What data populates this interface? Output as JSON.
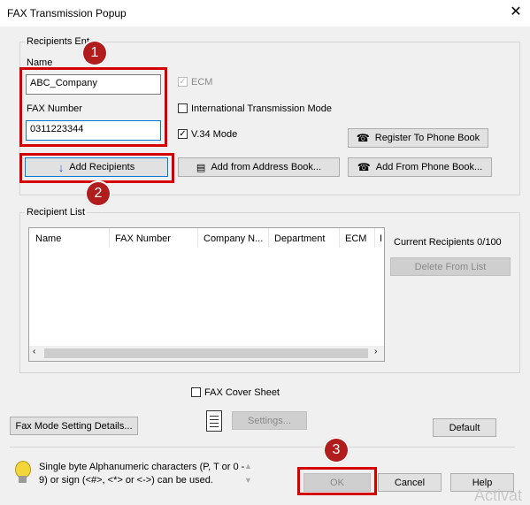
{
  "window": {
    "title": "FAX Transmission Popup",
    "close_glyph": "✕"
  },
  "recipients_entry": {
    "legend": "Recipients Ent",
    "name_label": "Name",
    "name_value": "ABC_Company",
    "fax_label": "FAX Number",
    "fax_value": "0311223344",
    "ecm_label": "ECM",
    "intl_label": "International Transmission Mode",
    "v34_label": "V.34 Mode",
    "check_glyph": "✓",
    "register_button": "Register To Phone Book",
    "add_recipients_button": "Add Recipients",
    "add_address_button": "Add from Address Book...",
    "add_phone_button": "Add From Phone Book..."
  },
  "recipient_list": {
    "legend": "Recipient List",
    "columns": [
      "Name",
      "FAX Number",
      "Company N...",
      "Department",
      "ECM",
      "I"
    ],
    "current_recipients": "Current Recipients 0/100",
    "delete_button": "Delete From List"
  },
  "cover_sheet": {
    "label": "FAX Cover Sheet",
    "settings_button": "Settings..."
  },
  "fax_mode_button": "Fax Mode Setting Details...",
  "default_button": "Default",
  "hint": {
    "text_line1": "Single byte Alphanumeric characters (P, T or 0 -",
    "text_line2": "9) or sign (<#>, <*> or <->) can be used."
  },
  "footer": {
    "ok": "OK",
    "cancel": "Cancel",
    "help": "Help"
  },
  "annotations": {
    "step1": "1",
    "step2": "2",
    "step3": "3"
  },
  "watermark": "Activat",
  "colors": {
    "highlight_red": "#d40000",
    "badge_red": "#b11c1c",
    "focus_blue": "#0078d7"
  }
}
